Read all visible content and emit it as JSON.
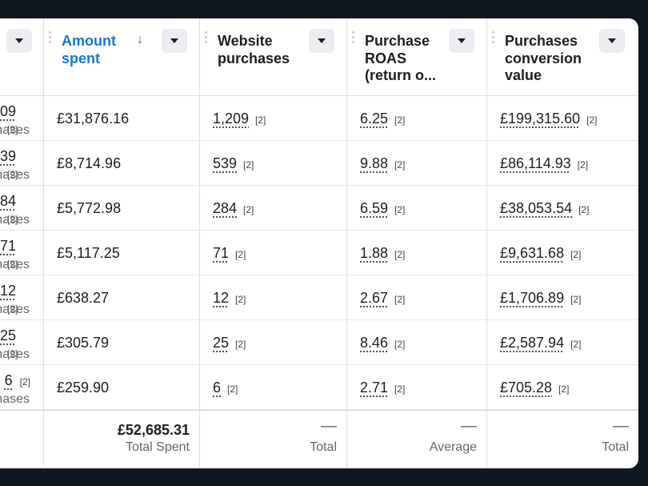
{
  "columns": {
    "results": {
      "rows": [
        {
          "value": "09",
          "badge": "[2]",
          "sub": "hases"
        },
        {
          "value": "39",
          "badge": "[2]",
          "sub": "hases"
        },
        {
          "value": "84",
          "badge": "[2]",
          "sub": "hases"
        },
        {
          "value": "71",
          "badge": "[2]",
          "sub": "hases"
        },
        {
          "value": "12",
          "badge": "[2]",
          "sub": "hases"
        },
        {
          "value": "25",
          "badge": "[2]",
          "sub": "hases"
        },
        {
          "value": "6",
          "badge": "[2]",
          "sub": "hases"
        }
      ]
    },
    "amount_spent": {
      "title": "Amount spent",
      "rows": [
        "£31,876.16",
        "£8,714.96",
        "£5,772.98",
        "£5,117.25",
        "£638.27",
        "£305.79",
        "£259.90"
      ],
      "footer_value": "£52,685.31",
      "footer_label": "Total Spent"
    },
    "website_purchases": {
      "title": "Website purchases",
      "rows": [
        {
          "value": "1,209",
          "badge": "[2]"
        },
        {
          "value": "539",
          "badge": "[2]"
        },
        {
          "value": "284",
          "badge": "[2]"
        },
        {
          "value": "71",
          "badge": "[2]"
        },
        {
          "value": "12",
          "badge": "[2]"
        },
        {
          "value": "25",
          "badge": "[2]"
        },
        {
          "value": "6",
          "badge": "[2]"
        }
      ],
      "footer_value": "—",
      "footer_label": "Total"
    },
    "purchase_roas": {
      "title": "Purchase ROAS (return o...",
      "rows": [
        {
          "value": "6.25",
          "badge": "[2]"
        },
        {
          "value": "9.88",
          "badge": "[2]"
        },
        {
          "value": "6.59",
          "badge": "[2]"
        },
        {
          "value": "1.88",
          "badge": "[2]"
        },
        {
          "value": "2.67",
          "badge": "[2]"
        },
        {
          "value": "8.46",
          "badge": "[2]"
        },
        {
          "value": "2.71",
          "badge": "[2]"
        }
      ],
      "footer_value": "—",
      "footer_label": "Average"
    },
    "purchases_conversion_value": {
      "title": "Purchases conversion value",
      "rows": [
        {
          "value": "£199,315.60",
          "badge": "[2]"
        },
        {
          "value": "£86,114.93",
          "badge": "[2]"
        },
        {
          "value": "£38,053.54",
          "badge": "[2]"
        },
        {
          "value": "£9,631.68",
          "badge": "[2]"
        },
        {
          "value": "£1,706.89",
          "badge": "[2]"
        },
        {
          "value": "£2,587.94",
          "badge": "[2]"
        },
        {
          "value": "£705.28",
          "badge": "[2]"
        }
      ],
      "footer_value": "—",
      "footer_label": "Total"
    }
  },
  "icons": {
    "sort": "arrow-down-icon",
    "dropdown": "caret-down-icon",
    "drag": "drag-handle-icon"
  },
  "colors": {
    "sorted_header": "#1877d2",
    "background": "#0f1720"
  }
}
